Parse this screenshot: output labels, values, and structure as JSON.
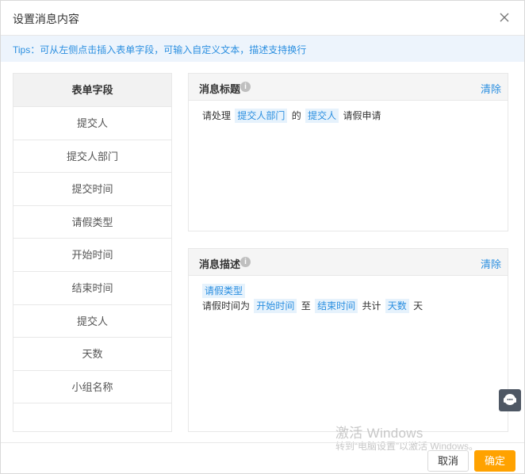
{
  "dialog": {
    "title": "设置消息内容",
    "tips": "Tips：可从左侧点击插入表单字段，可输入自定义文本，描述支持换行"
  },
  "fields": {
    "header": "表单字段",
    "items": [
      "提交人",
      "提交人部门",
      "提交时间",
      "请假类型",
      "开始时间",
      "结束时间",
      "提交人",
      "天数",
      "小组名称"
    ]
  },
  "message_title": {
    "label": "消息标题",
    "clear": "清除",
    "content": {
      "t1": "请处理",
      "tag1": "提交人部门",
      "t2": "的",
      "tag2": "提交人",
      "t3": "请假申请"
    }
  },
  "message_desc": {
    "label": "消息描述",
    "clear": "清除",
    "content": {
      "tag0": "请假类型",
      "t1": "请假时间为",
      "tag1": "开始时间",
      "t2": "至",
      "tag2": "结束时间",
      "t3": "共计",
      "tag3": "天数",
      "t4": "天"
    }
  },
  "footer": {
    "cancel": "取消",
    "confirm": "确定"
  },
  "watermark": {
    "line1": "激活 Windows",
    "line2": "转到“电脑设置”以激活 Windows。"
  },
  "colors": {
    "accent": "#2b8fe0",
    "tips_bg": "#edf4fc",
    "confirm": "#ffa200"
  }
}
